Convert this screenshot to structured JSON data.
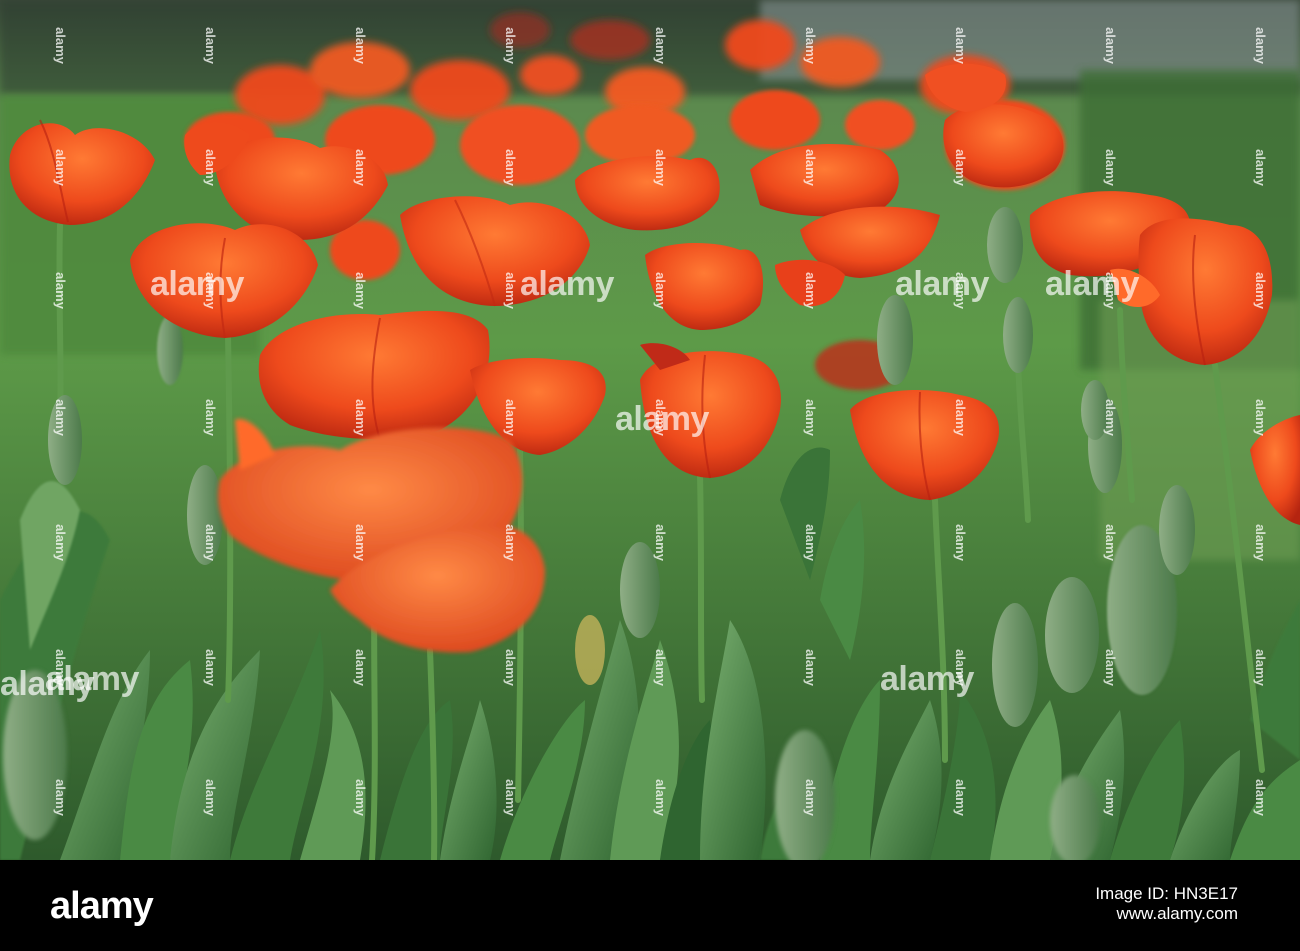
{
  "photo": {
    "subject": "field of red-orange tulips with green leaves and buds",
    "colors": {
      "petal": "#e8401a",
      "petal_light": "#ff6a2a",
      "petal_dark": "#b82010",
      "leaf": "#3e7a3a",
      "leaf_light": "#6fa564",
      "stem": "#5f9a4c",
      "grass": "#4f8f3a"
    }
  },
  "footer": {
    "logo": "alamy",
    "image_id_label": "Image ID: HN3E17",
    "site": "www.alamy.com"
  },
  "watermark": {
    "tile": "alamy",
    "main": "alamy"
  }
}
